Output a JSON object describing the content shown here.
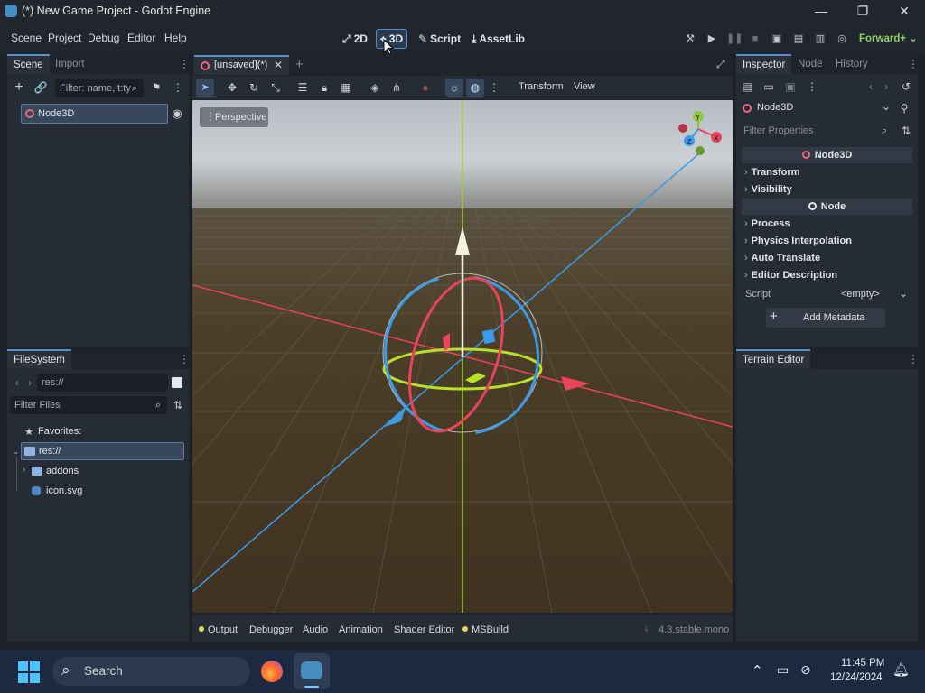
{
  "window": {
    "title": "(*) New Game Project - Godot Engine",
    "minimize": "—",
    "maximize": "❐",
    "close": "✕"
  },
  "menu": [
    "Scene",
    "Project",
    "Debug",
    "Editor",
    "Help"
  ],
  "workspaces": {
    "w2d": "2D",
    "w3d": "3D",
    "script": "Script",
    "assetlib": "AssetLib"
  },
  "renderer": "Forward+",
  "scene_dock": {
    "tabs": [
      "Scene",
      "Import"
    ],
    "filter_placeholder": "Filter: name, t:ty",
    "root_node": "Node3D"
  },
  "filesystem": {
    "tab": "FileSystem",
    "path": "res://",
    "filter_placeholder": "Filter Files",
    "favorites": "Favorites:",
    "items": [
      "res://",
      "addons",
      "icon.svg"
    ]
  },
  "viewport": {
    "tab": "[unsaved](*)",
    "perspective": "Perspective",
    "transform_menu": "Transform",
    "view_menu": "View",
    "gizmo": {
      "y": "Y",
      "x": "X",
      "z": "Z"
    }
  },
  "bottom_panel": {
    "tabs": [
      "Output",
      "Debugger",
      "Audio",
      "Animation",
      "Shader Editor",
      "MSBuild"
    ],
    "version": "4.3.stable.mono"
  },
  "inspector": {
    "tabs": [
      "Inspector",
      "Node",
      "History"
    ],
    "selected": "Node3D",
    "filter_placeholder": "Filter Properties",
    "section_node3d": "Node3D",
    "node3d_props": [
      "Transform",
      "Visibility"
    ],
    "section_node": "Node",
    "node_props": [
      "Process",
      "Physics Interpolation",
      "Auto Translate",
      "Editor Description"
    ],
    "script_label": "Script",
    "script_value": "<empty>",
    "add_metadata": "Add Metadata"
  },
  "terrain": {
    "tab": "Terrain Editor"
  },
  "taskbar": {
    "search": "Search",
    "time": "11:45 PM",
    "date": "12/24/2024"
  },
  "colors": {
    "accent": "#5a8fd0",
    "x_axis": "#e8445a",
    "y_axis": "#9ad42a",
    "z_axis": "#3c9ae8",
    "sky": "#c9cdd2",
    "ground": "#4a3c24"
  }
}
